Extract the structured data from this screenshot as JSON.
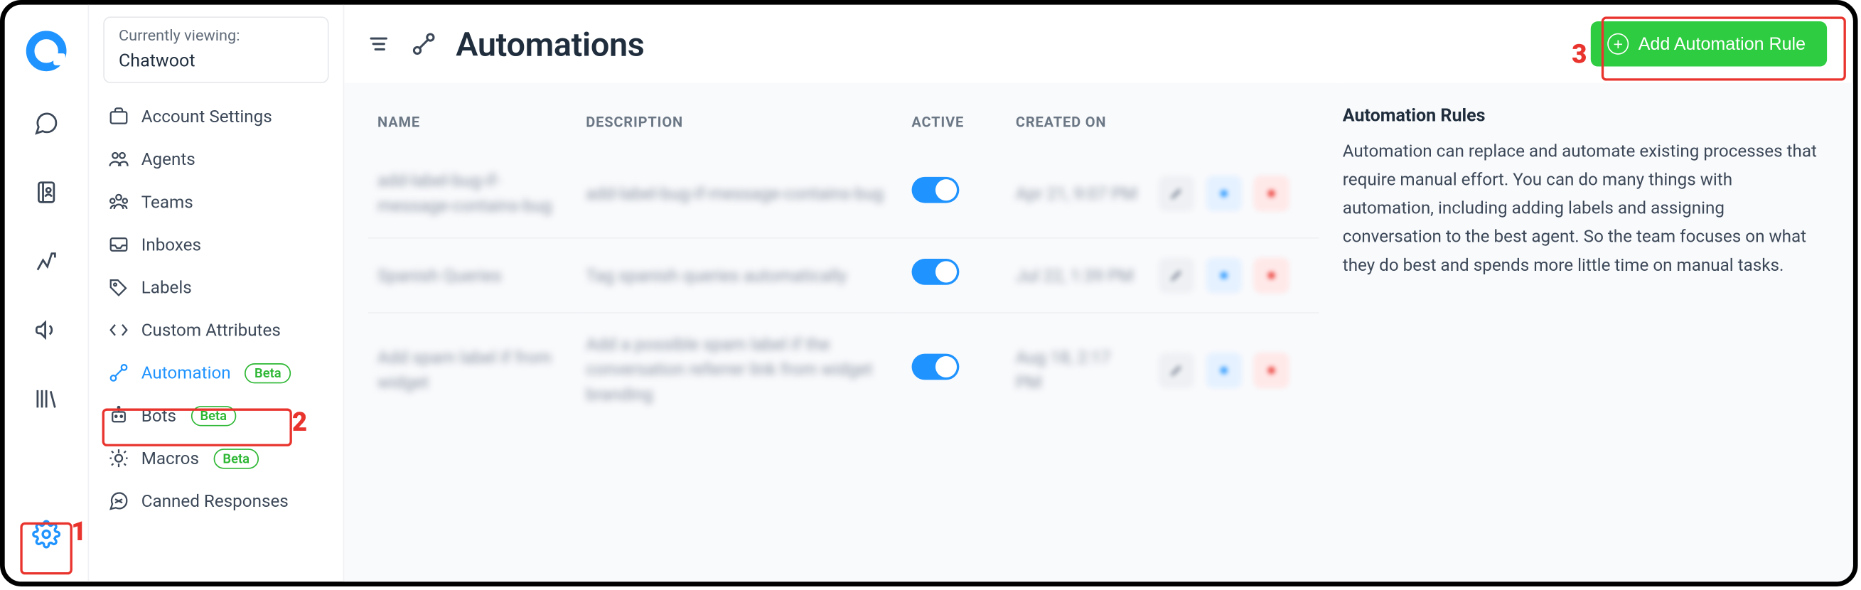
{
  "viewing": {
    "label": "Currently viewing:",
    "value": "Chatwoot"
  },
  "sidebar": {
    "items": [
      {
        "label": "Account Settings"
      },
      {
        "label": "Agents"
      },
      {
        "label": "Teams"
      },
      {
        "label": "Inboxes"
      },
      {
        "label": "Labels"
      },
      {
        "label": "Custom Attributes"
      },
      {
        "label": "Automation",
        "badge": "Beta"
      },
      {
        "label": "Bots",
        "badge": "Beta"
      },
      {
        "label": "Macros",
        "badge": "Beta"
      },
      {
        "label": "Canned Responses"
      }
    ]
  },
  "page": {
    "title": "Automations"
  },
  "add_button": {
    "label": "Add Automation Rule"
  },
  "table": {
    "headers": {
      "name": "NAME",
      "description": "DESCRIPTION",
      "active": "ACTIVE",
      "created": "CREATED ON"
    },
    "rows": [
      {
        "name": "add-label-bug-if-message-contains-bug",
        "description": "add-label-bug-if-message-contains-bug",
        "created": "Apr 21, 9:07 PM"
      },
      {
        "name": "Spanish Queries",
        "description": "Tag spanish queries automatically",
        "created": "Jul 22, 1:39 PM"
      },
      {
        "name": "Add spam label if from widget",
        "description": "Add a possible spam label if the conversation referrer link from widget branding",
        "created": "Aug 18, 2:17 PM"
      }
    ]
  },
  "info": {
    "title": "Automation Rules",
    "text": "Automation can replace and automate existing processes that require manual effort. You can do many things with automation, including adding labels and assigning conversation to the best agent. So the team focuses on what they do best and spends more little time on manual tasks."
  },
  "annotations": {
    "n1": "1",
    "n2": "2",
    "n3": "3"
  }
}
